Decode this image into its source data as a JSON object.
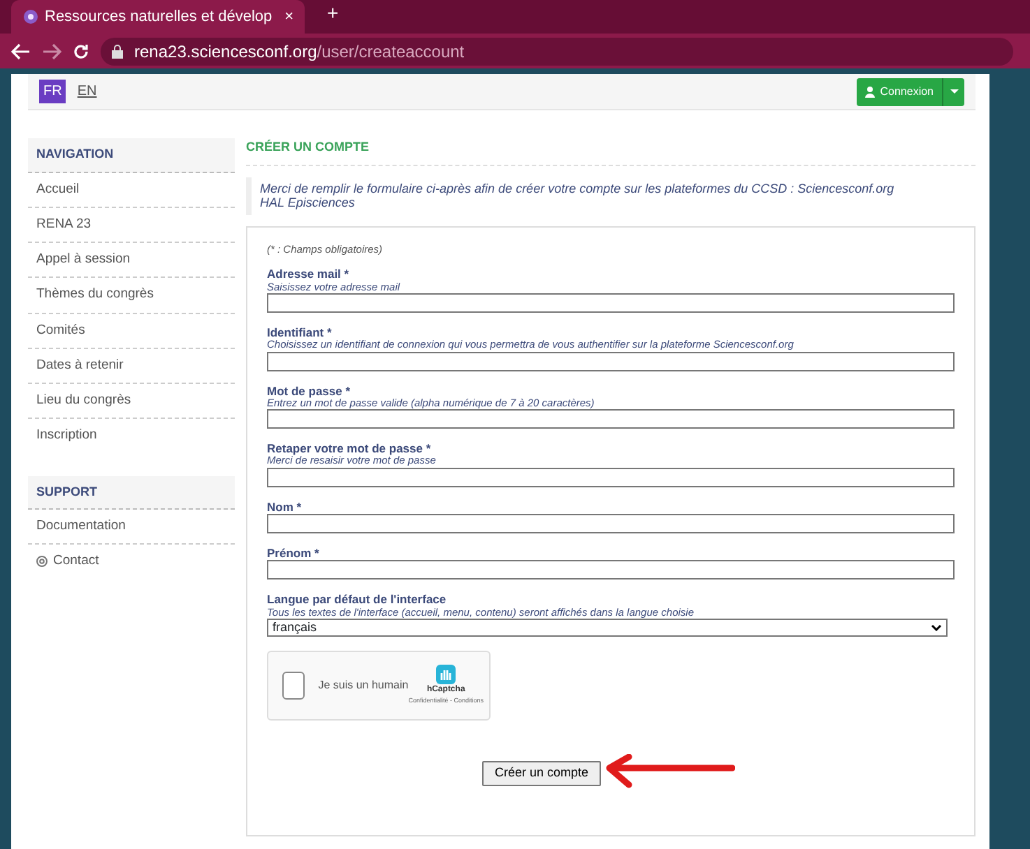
{
  "browser": {
    "tab_title": "Ressources naturelles et dévelop",
    "tab_close": "×",
    "new_tab": "+",
    "url_host": "rena23.sciencesconf.org",
    "url_path": "/user/createaccount"
  },
  "languages": [
    {
      "label": "FR",
      "selected": true
    },
    {
      "label": "EN",
      "selected": false
    }
  ],
  "login_button": "Connexion",
  "sidebar": [
    {
      "title": "NAVIGATION",
      "items": [
        {
          "label": "Accueil",
          "kind": "link"
        },
        {
          "label": "RENA 23",
          "kind": "link"
        },
        {
          "label": "Appel à session",
          "kind": "link"
        },
        {
          "label": "Thèmes du congrès",
          "kind": "link"
        },
        {
          "label": "Comités",
          "kind": "link"
        },
        {
          "label": "Dates à retenir",
          "kind": "link"
        },
        {
          "label": "Lieu du congrès",
          "kind": "link"
        },
        {
          "label": "Inscription",
          "kind": "link"
        }
      ]
    },
    {
      "title": "SUPPORT",
      "items": [
        {
          "label": "Documentation",
          "kind": "link"
        },
        {
          "label": "Contact",
          "kind": "contact"
        }
      ]
    }
  ],
  "page": {
    "title": "CRÉER UN COMPTE",
    "intro": [
      "Merci de remplir le formulaire ci-après afin de créer votre compte sur les plateformes du CCSD : Sciencesconf.org",
      "HAL Episciences"
    ]
  },
  "form": {
    "required_note": "(* : Champs obligatoires)",
    "fields": [
      {
        "label": "Adresse mail *",
        "hint": "Saisissez votre adresse mail",
        "kind": "text"
      },
      {
        "label": "Identifiant *",
        "hint": "Choisissez un identifiant de connexion qui vous permettra de vous authentifier sur la plateforme Sciencesconf.org",
        "kind": "text"
      },
      {
        "label": "Mot de passe *",
        "hint": "Entrez un mot de passe valide (alpha numérique de 7 à 20 caractères)",
        "kind": "text"
      },
      {
        "label": "Retaper votre mot de passe *",
        "hint": "Merci de resaisir votre mot de passe",
        "kind": "text"
      },
      {
        "label": "Nom *",
        "kind": "text"
      },
      {
        "label": "Prénom *",
        "kind": "text"
      },
      {
        "label": "Langue par défaut de l'interface",
        "hint": "Tous les textes de l'interface (accueil, menu, contenu) seront affichés dans la langue choisie",
        "kind": "select",
        "value": "français"
      }
    ],
    "captcha": {
      "label": "Je suis un humain",
      "checked": false,
      "brand": "hCaptcha",
      "links": "Confidentialité - Conditions"
    },
    "submit": "Créer un compte"
  }
}
